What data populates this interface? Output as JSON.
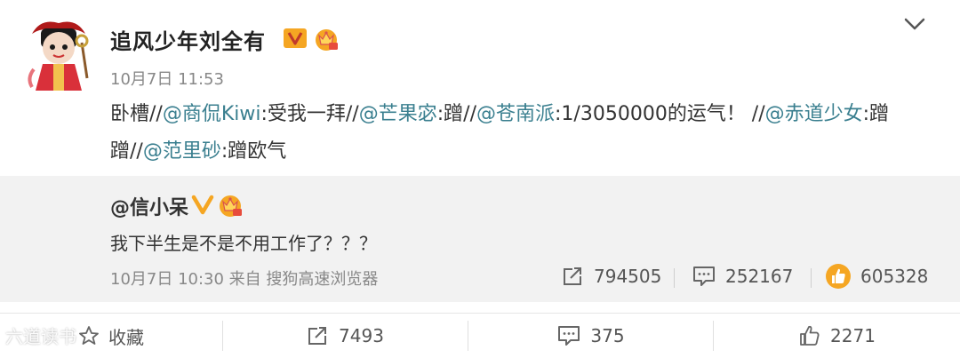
{
  "post": {
    "author": "追风少年刘全有",
    "time": "10月7日 11:53",
    "content": [
      {
        "t": "卧槽//"
      },
      {
        "t": "@商侃Kiwi",
        "mention": true
      },
      {
        "t": ":受我一拜//"
      },
      {
        "t": "@芒果宓",
        "mention": true
      },
      {
        "t": ":蹭//"
      },
      {
        "t": "@苍南派",
        "mention": true
      },
      {
        "t": ":1/3050000的运气！ //"
      },
      {
        "t": "@赤道少女",
        "mention": true
      },
      {
        "t": ":蹭蹭//"
      },
      {
        "t": "@范里砂",
        "mention": true
      },
      {
        "t": ":蹭欧气"
      }
    ]
  },
  "repost": {
    "author": "@信小呆",
    "text": "我下半生是不是不用工作了？？？",
    "meta": "10月7日 10:30 来自 搜狗高速浏览器",
    "reposts": "794505",
    "comments": "252167",
    "likes": "605328"
  },
  "actions": {
    "favorite": "收藏",
    "reposts": "7493",
    "comments": "375",
    "likes": "2271"
  },
  "watermark": "六道读书",
  "colors": {
    "mention": "#3a7f8f",
    "badge_orange": "#f5a623",
    "repost_bg": "#f2f2f2"
  },
  "icons": [
    "chevron-down-icon",
    "verified-v-icon",
    "crown-icon",
    "repost-icon",
    "comment-icon",
    "like-icon",
    "star-icon"
  ]
}
